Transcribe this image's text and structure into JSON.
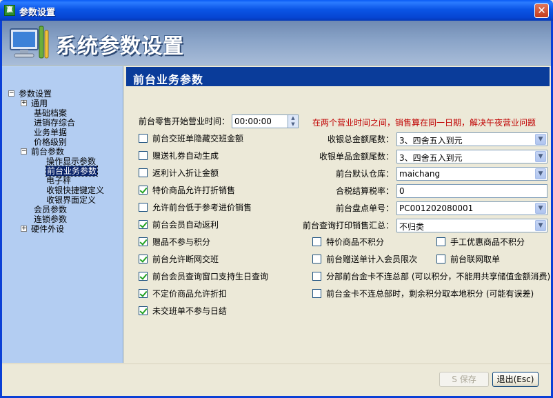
{
  "window": {
    "title": "参数设置",
    "app_icon": "赢",
    "close_glyph": "✕"
  },
  "banner": {
    "title": "系统参数设置"
  },
  "tree": [
    {
      "label": "参数设置",
      "expander": "−"
    },
    {
      "label": "通用",
      "expander": "+"
    },
    {
      "label": "基础档案"
    },
    {
      "label": "进销存综合"
    },
    {
      "label": "业务单据"
    },
    {
      "label": "价格级别"
    },
    {
      "label": "前台参数",
      "expander": "−"
    },
    {
      "label": "操作显示参数"
    },
    {
      "label": "前台业务参数",
      "selected": true
    },
    {
      "label": "电子秤"
    },
    {
      "label": "收银快捷键定义"
    },
    {
      "label": "收银界面定义"
    },
    {
      "label": "会员参数"
    },
    {
      "label": "连锁参数"
    },
    {
      "label": "硬件外设",
      "expander": "+"
    }
  ],
  "section": {
    "title": "前台业务参数"
  },
  "start_time": {
    "label": "前台零售开始营业时间：",
    "value": "00:00:00"
  },
  "note": "在两个营业时间之间，销售算在同一日期，解决午夜营业问题",
  "left_checks": [
    {
      "label": "前台交班单隐藏交班金额",
      "checked": false
    },
    {
      "label": "赠送礼券自动生成",
      "checked": false
    },
    {
      "label": "返利计入折让金额",
      "checked": false
    },
    {
      "label": "特价商品允许打折销售",
      "checked": true
    },
    {
      "label": "允许前台低于参考进价销售",
      "checked": false
    },
    {
      "label": "前台会员自动返利",
      "checked": true
    },
    {
      "label": "赠品不参与积分",
      "checked": true
    },
    {
      "label": "前台允许断网交班",
      "checked": true
    },
    {
      "label": "前台会员查询窗口支持生日查询",
      "checked": true
    },
    {
      "label": "不定价商品允许折扣",
      "checked": true
    },
    {
      "label": "未交班单不参与日结",
      "checked": true
    }
  ],
  "fields": {
    "total_tail": {
      "label": "收银总金额尾数：",
      "value": "3、四舍五入到元"
    },
    "single_tail": {
      "label": "收银单品金额尾数：",
      "value": "3、四舍五入到元"
    },
    "warehouse": {
      "label": "前台默认仓库：",
      "value": "maichang"
    },
    "tax_rate": {
      "label": "合税结算税率：",
      "value": "0"
    },
    "stocktake_no": {
      "label": "前台盘点单号：",
      "value": "PC001202080001"
    },
    "query_summary": {
      "label": "前台查询打印销售汇总：",
      "value": "不归类"
    }
  },
  "right_checks": [
    {
      "label": "特价商品不积分",
      "checked": false
    },
    {
      "label": "手工优惠商品不积分",
      "checked": false
    },
    {
      "label": "前台赠送单计入会员限次",
      "checked": false
    },
    {
      "label": "前台联网取单",
      "checked": false
    },
    {
      "label": "分部前台金卡不连总部 (可以积分，不能用共享储值金额消费)",
      "checked": false
    },
    {
      "label": "前台金卡不连总部时，剩余积分取本地积分 (可能有误差)",
      "checked": false
    }
  ],
  "footer": {
    "save": "S 保存",
    "exit": "退出(Esc)"
  },
  "colors": {
    "titlebar": "#0a55e6",
    "header": "#0a3c9a",
    "tree_bg": "#b3cdf2",
    "note": "#c00000",
    "check": "#21a121"
  }
}
